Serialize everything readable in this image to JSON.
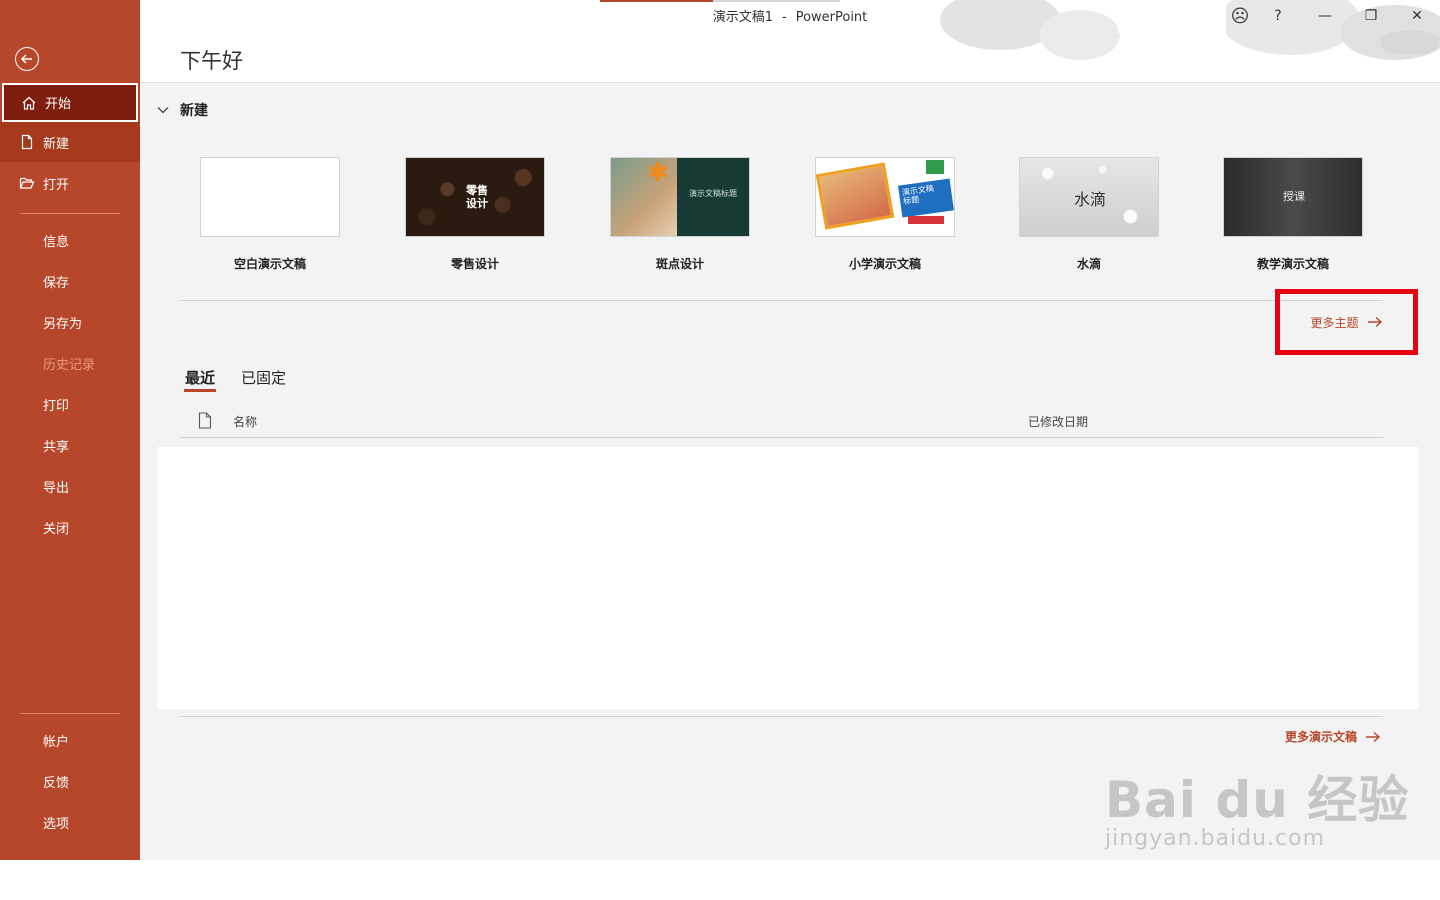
{
  "window": {
    "title_doc": "演示文稿1",
    "title_sep": "-",
    "title_app": "PowerPoint",
    "controls": {
      "feedback": "☹",
      "help": "?",
      "minimize": "—",
      "restore": "❐",
      "close": "✕"
    },
    "progress_fraction": 0.47
  },
  "sidebar": {
    "back_icon": "back-arrow-icon",
    "items_top": [
      {
        "label": "开始",
        "icon": "home-icon",
        "state": "active"
      },
      {
        "label": "新建",
        "icon": "new-file-icon",
        "state": "hover"
      },
      {
        "label": "打开",
        "icon": "folder-open-icon",
        "state": "normal"
      }
    ],
    "items_mid": [
      {
        "label": "信息",
        "state": "normal"
      },
      {
        "label": "保存",
        "state": "normal"
      },
      {
        "label": "另存为",
        "state": "normal"
      },
      {
        "label": "历史记录",
        "state": "disabled"
      },
      {
        "label": "打印",
        "state": "normal"
      },
      {
        "label": "共享",
        "state": "normal"
      },
      {
        "label": "导出",
        "state": "normal"
      },
      {
        "label": "关闭",
        "state": "normal"
      }
    ],
    "items_bottom": [
      {
        "label": "帐户",
        "state": "normal"
      },
      {
        "label": "反馈",
        "state": "normal"
      },
      {
        "label": "选项",
        "state": "normal"
      }
    ]
  },
  "header": {
    "greeting": "下午好"
  },
  "new_section": {
    "heading": "新建",
    "templates": [
      {
        "name": "空白演示文稿",
        "thumb_text": "",
        "sub_text": ""
      },
      {
        "name": "零售设计",
        "thumb_text": "零售\n设计",
        "sub_text": ""
      },
      {
        "name": "斑点设计",
        "thumb_text": "演示文稿标题",
        "sub_text": ""
      },
      {
        "name": "小学演示文稿",
        "thumb_text": "演示文稿\n标题",
        "sub_text": ""
      },
      {
        "name": "水滴",
        "thumb_text": "水滴",
        "sub_text": ""
      },
      {
        "name": "教学演示文稿",
        "thumb_text": "授课",
        "sub_text": ""
      }
    ],
    "more_themes": "更多主题"
  },
  "recent": {
    "tabs": [
      {
        "label": "最近",
        "active": true
      },
      {
        "label": "已固定",
        "active": false
      }
    ],
    "columns": {
      "name": "名称",
      "modified": "已修改日期"
    },
    "more_docs": "更多演示文稿"
  },
  "watermark": {
    "line1": "Bai du 经验",
    "line2": "jingyan.baidu.com"
  },
  "colors": {
    "accent": "#b7472a",
    "active_nav": "#7e1e0f",
    "highlight_box": "#e60012"
  }
}
